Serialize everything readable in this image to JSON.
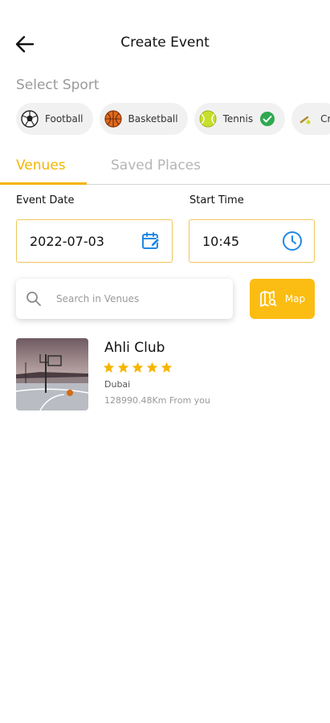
{
  "header": {
    "title": "Create Event"
  },
  "sport_section": {
    "label": "Select Sport",
    "sports": [
      {
        "name": "Football",
        "selected": false
      },
      {
        "name": "Basketball",
        "selected": false
      },
      {
        "name": "Tennis",
        "selected": true
      },
      {
        "name": "Cr",
        "selected": false
      }
    ]
  },
  "tabs": {
    "venues": "Venues",
    "saved_places": "Saved Places",
    "active": "Venues"
  },
  "event_date": {
    "label": "Event Date",
    "value": "2022-07-03",
    "icon": "calendar-edit-icon"
  },
  "start_time": {
    "label": "Start Time",
    "value": "10:45",
    "icon": "clock-icon"
  },
  "search": {
    "placeholder": "Search in Venues"
  },
  "map_button": {
    "label": "Map",
    "icon": "map-search-icon"
  },
  "venues": [
    {
      "name": "Ahli Club",
      "rating": 5,
      "city": "Dubai",
      "distance": "128990.48Km From you"
    }
  ],
  "colors": {
    "accent": "#fbbd12",
    "tab_active": "#f5b400",
    "icon_blue": "#1e88e5",
    "star": "#f7b500",
    "check": "#2fa84f"
  }
}
